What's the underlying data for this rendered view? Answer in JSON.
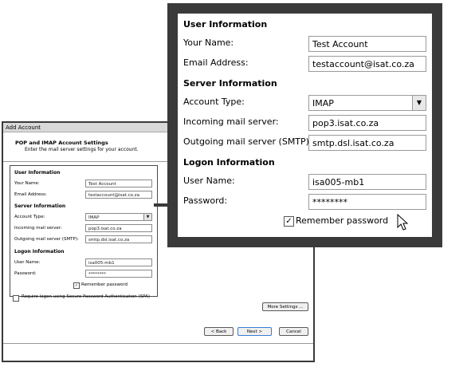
{
  "dialog": {
    "window_title": "Add Account",
    "header_title": "POP and IMAP Account Settings",
    "header_subtitle": "Enter the mail server settings for your account.",
    "sections": {
      "user_info": "User Information",
      "server_info": "Server Information",
      "logon_info": "Logon Information"
    },
    "labels": {
      "your_name": "Your Name:",
      "email": "Email Address:",
      "account_type": "Account Type:",
      "incoming": "Incoming mail server:",
      "outgoing": "Outgoing mail server (SMTP):",
      "user_name": "User Name:",
      "password": "Password:",
      "remember": "Remember password",
      "spa": "Require logon using Secure Password Authentication (SPA)"
    },
    "values": {
      "your_name": "Test Account",
      "email": "testaccount@isat.co.za",
      "account_type": "IMAP",
      "incoming": "pop3.isat.co.za",
      "outgoing": "smtp.dsl.isat.co.za",
      "user_name": "isa005-mb1",
      "password": "********"
    },
    "remember_checked": true,
    "spa_checked": false,
    "buttons": {
      "more_settings": "More Settings ...",
      "back": "< Back",
      "next": "Next >",
      "cancel": "Cancel"
    }
  },
  "zoom": {
    "sections": {
      "user_info": "User Information",
      "server_info": "Server Information",
      "logon_info": "Logon Information"
    },
    "labels": {
      "your_name": "Your Name:",
      "email": "Email Address:",
      "account_type": "Account Type:",
      "incoming": "Incoming mail server:",
      "outgoing": "Outgoing mail server (SMTP):",
      "user_name": "User Name:",
      "password": "Password:",
      "remember": "Remember password"
    },
    "values": {
      "your_name": "Test Account",
      "email": "testaccount@isat.co.za",
      "account_type": "IMAP",
      "incoming": "pop3.isat.co.za",
      "outgoing": "smtp.dsl.isat.co.za",
      "user_name": "isa005-mb1",
      "password": "********"
    },
    "remember_checked": true
  },
  "icons": {
    "check": "✓",
    "dropdown": "▼"
  }
}
